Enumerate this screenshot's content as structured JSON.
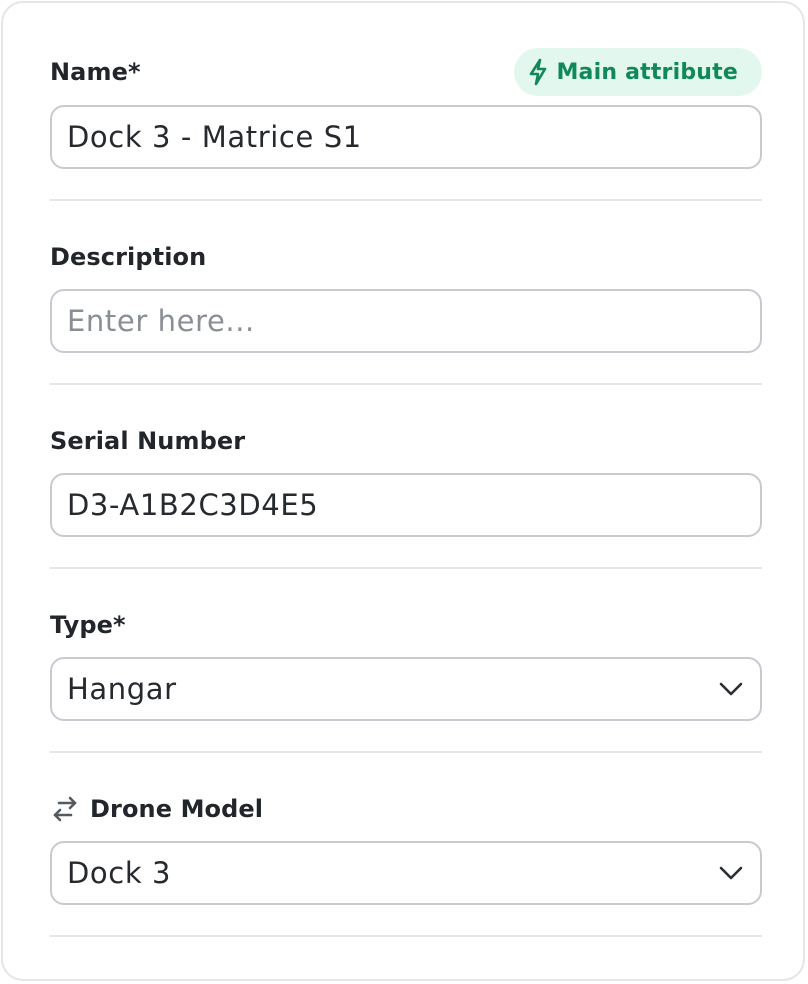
{
  "form": {
    "name": {
      "label": "Name*",
      "value": "Dock 3 - Matrice S1",
      "badge": "Main attribute"
    },
    "description": {
      "label": "Description",
      "placeholder": "Enter here..."
    },
    "serial_number": {
      "label": "Serial Number",
      "value": "D3-A1B2C3D4E5"
    },
    "type": {
      "label": "Type*",
      "selected": "Hangar"
    },
    "drone_model": {
      "label": "Drone Model",
      "selected": "Dock 3"
    }
  },
  "icons": {
    "badge_icon": "lightning-bolt-icon",
    "relation_icon": "swap-arrows-icon",
    "dropdown_icon": "chevron-down-icon"
  },
  "colors": {
    "badge_bg": "#e2f8ee",
    "badge_text": "#10885a",
    "border": "#c7cacf",
    "divider": "#e3e5e8"
  }
}
